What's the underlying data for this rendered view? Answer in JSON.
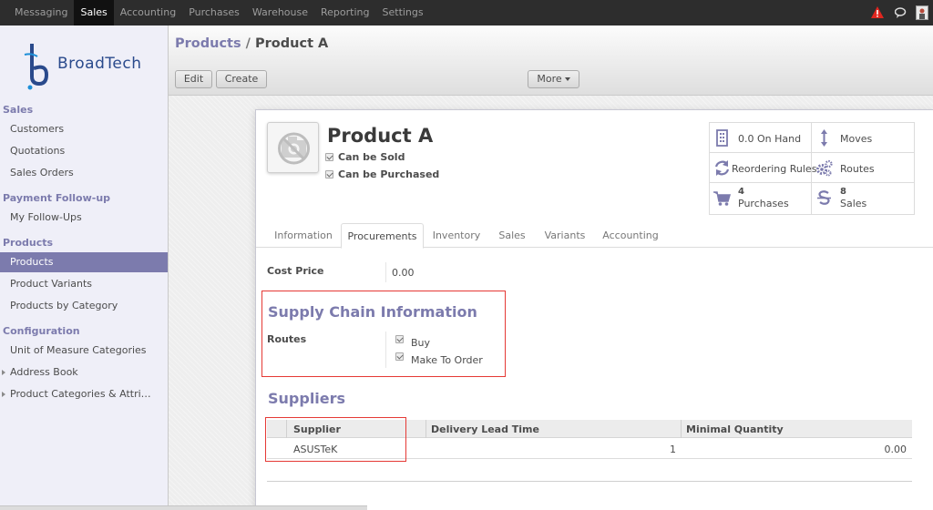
{
  "topmenu": {
    "items": [
      "Messaging",
      "Sales",
      "Accounting",
      "Purchases",
      "Warehouse",
      "Reporting",
      "Settings"
    ],
    "active_index": 1
  },
  "brand": {
    "logo_text": "BroadTech"
  },
  "sidebar": {
    "sections": [
      {
        "title": "Sales",
        "items": [
          "Customers",
          "Quotations",
          "Sales Orders"
        ]
      },
      {
        "title": "Payment Follow-up",
        "items": [
          "My Follow-Ups"
        ]
      },
      {
        "title": "Products",
        "items": [
          "Products",
          "Product Variants",
          "Products by Category"
        ]
      },
      {
        "title": "Configuration",
        "items": [
          "Unit of Measure Categories",
          "Address Book",
          "Product Categories & Attri…"
        ]
      }
    ],
    "active_item": "Products"
  },
  "breadcrumb": {
    "parent": "Products",
    "separator": "/",
    "current": "Product A"
  },
  "buttons": {
    "edit": "Edit",
    "create": "Create",
    "more": "More"
  },
  "product": {
    "name": "Product A",
    "can_be_sold": "Can be Sold",
    "can_be_purchased": "Can be Purchased"
  },
  "stats": {
    "on_hand": "0.0 On Hand",
    "moves": "Moves",
    "reordering": "Reordering Rules",
    "routes": "Routes",
    "purchases_count": "4",
    "purchases_label": "Purchases",
    "sales_count": "8",
    "sales_label": "Sales"
  },
  "tabs": [
    "Information",
    "Procurements",
    "Inventory",
    "Sales",
    "Variants",
    "Accounting"
  ],
  "active_tab": "Procurements",
  "procurements": {
    "cost_price_label": "Cost Price",
    "cost_price_value": "0.00",
    "supply_chain_title": "Supply Chain Information",
    "routes_label": "Routes",
    "routes": [
      "Buy",
      "Make To Order"
    ],
    "suppliers_title": "Suppliers",
    "columns": [
      "Supplier",
      "Delivery Lead Time",
      "Minimal Quantity"
    ],
    "rows": [
      {
        "supplier": "ASUSTeK",
        "lead_time": "1",
        "min_qty": "0.00"
      }
    ]
  },
  "colors": {
    "brand": "#7c7bad",
    "topbar": "#2d2d2d",
    "highlight": "#e53935"
  }
}
